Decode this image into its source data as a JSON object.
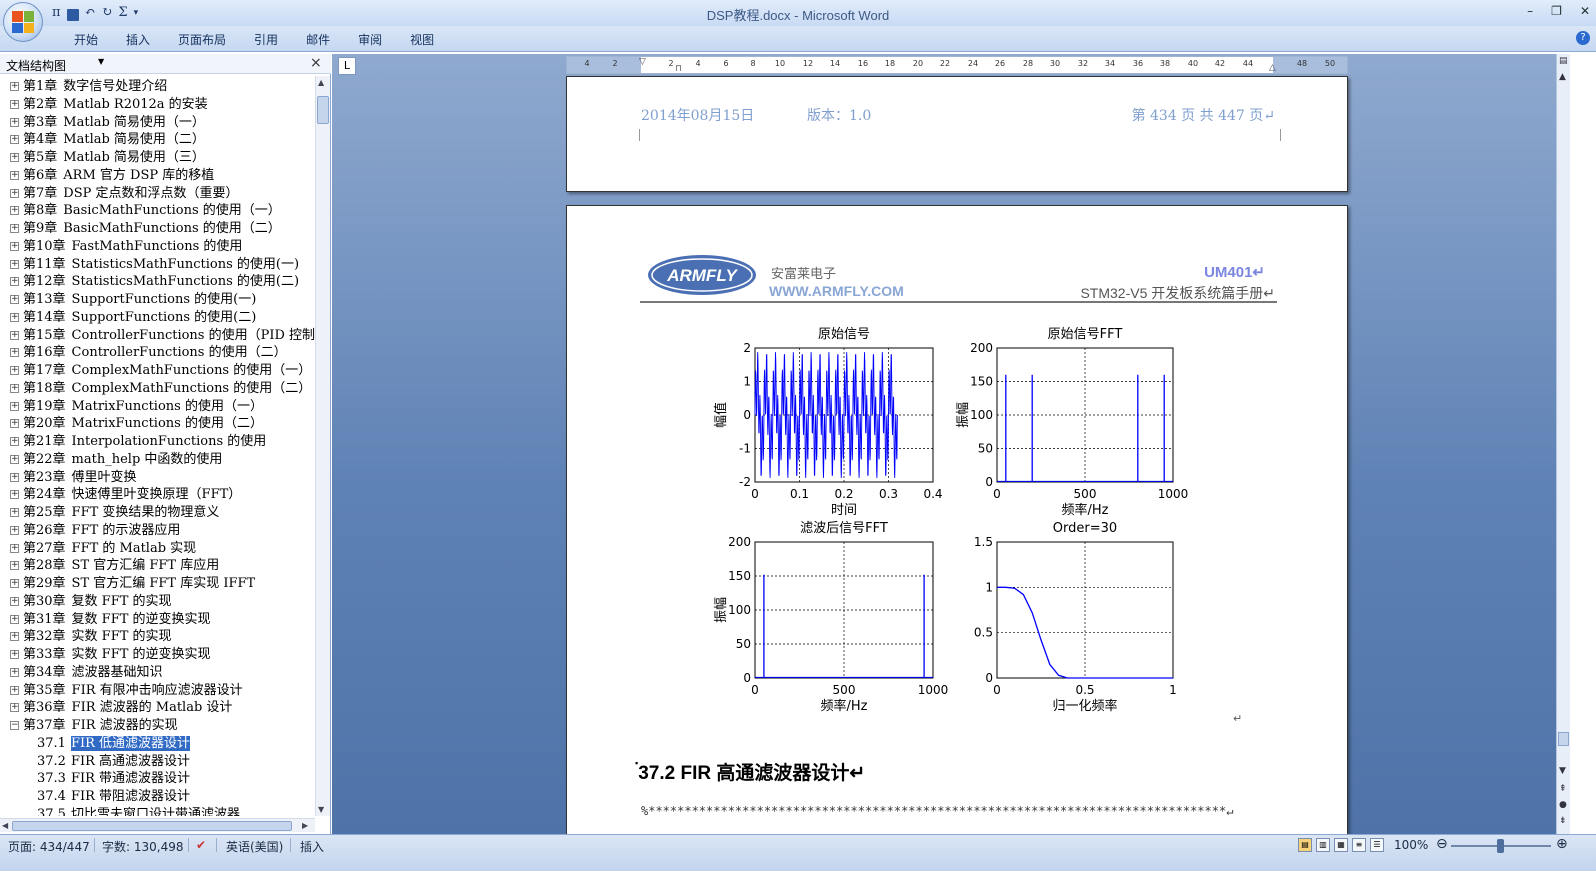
{
  "window": {
    "title": "DSP教程.docx - Microsoft Word",
    "qat": [
      "π",
      "💾",
      "↶",
      "↻",
      "Σ",
      "▾"
    ],
    "controls": [
      "–",
      "❐",
      "✕"
    ]
  },
  "ribbon": {
    "tabs": [
      "开始",
      "插入",
      "页面布局",
      "引用",
      "邮件",
      "审阅",
      "视图"
    ]
  },
  "nav": {
    "title": "文档结构图",
    "items": [
      {
        "prefix": "第1章",
        "text": "数字信号处理介绍",
        "exp": "⊞"
      },
      {
        "prefix": "第2章",
        "text": "Matlab R2012a 的安装",
        "exp": "⊞"
      },
      {
        "prefix": "第3章",
        "text": "Matlab  简易使用（一）",
        "exp": "⊞"
      },
      {
        "prefix": "第4章",
        "text": "Matlab  简易使用（二）",
        "exp": "⊞"
      },
      {
        "prefix": "第5章",
        "text": "Matlab  简易使用（三）",
        "exp": "⊞"
      },
      {
        "prefix": "第6章",
        "text": "ARM 官方 DSP 库的移植",
        "exp": "⊞"
      },
      {
        "prefix": "第7章",
        "text": "DSP 定点数和浮点数（重要）",
        "exp": "⊞"
      },
      {
        "prefix": "第8章",
        "text": "BasicMathFunctions 的使用（一）",
        "exp": "⊞"
      },
      {
        "prefix": "第9章",
        "text": "BasicMathFunctions 的使用（二）",
        "exp": "⊞"
      },
      {
        "prefix": "第10章",
        "text": "FastMathFunctions 的使用",
        "exp": "⊞"
      },
      {
        "prefix": "第11章",
        "text": "StatisticsMathFunctions 的使用(一)",
        "exp": "⊞"
      },
      {
        "prefix": "第12章",
        "text": "StatisticsMathFunctions 的使用(二)",
        "exp": "⊞"
      },
      {
        "prefix": "第13章",
        "text": "SupportFunctions 的使用(一)",
        "exp": "⊞"
      },
      {
        "prefix": "第14章",
        "text": "SupportFunctions 的使用(二)",
        "exp": "⊞"
      },
      {
        "prefix": "第15章",
        "text": "ControllerFunctions 的使用（PID 控制）",
        "exp": "⊞"
      },
      {
        "prefix": "第16章",
        "text": "ControllerFunctions 的使用（二）",
        "exp": "⊞"
      },
      {
        "prefix": "第17章",
        "text": "ComplexMathFunctions 的使用（一）",
        "exp": "⊞"
      },
      {
        "prefix": "第18章",
        "text": "ComplexMathFunctions 的使用（二）",
        "exp": "⊞"
      },
      {
        "prefix": "第19章",
        "text": "MatrixFunctions 的使用（一）",
        "exp": "⊞"
      },
      {
        "prefix": "第20章",
        "text": "MatrixFunctions 的使用（二）",
        "exp": "⊞"
      },
      {
        "prefix": "第21章",
        "text": "InterpolationFunctions 的使用",
        "exp": "⊞"
      },
      {
        "prefix": "第22章",
        "text": "math_help 中函数的使用",
        "exp": "⊞"
      },
      {
        "prefix": "第23章",
        "text": "傅里叶变换",
        "exp": "⊞"
      },
      {
        "prefix": "第24章",
        "text": "快速傅里叶变换原理（FFT）",
        "exp": "⊞"
      },
      {
        "prefix": "第25章",
        "text": "FFT 变换结果的物理意义",
        "exp": "⊞"
      },
      {
        "prefix": "第26章",
        "text": "FFT 的示波器应用",
        "exp": "⊞"
      },
      {
        "prefix": "第27章",
        "text": "FFT 的 Matlab 实现",
        "exp": "⊞"
      },
      {
        "prefix": "第28章",
        "text": "ST 官方汇编 FFT 库应用",
        "exp": "⊞"
      },
      {
        "prefix": "第29章",
        "text": "ST 官方汇编 FFT 库实现 IFFT",
        "exp": "⊞"
      },
      {
        "prefix": "第30章",
        "text": "复数 FFT 的实现",
        "exp": "⊞"
      },
      {
        "prefix": "第31章",
        "text": "复数 FFT 的逆变换实现",
        "exp": "⊞"
      },
      {
        "prefix": "第32章",
        "text": "实数 FFT 的实现",
        "exp": "⊞"
      },
      {
        "prefix": "第33章",
        "text": "实数 FFT 的逆变换实现",
        "exp": "⊞"
      },
      {
        "prefix": "第34章",
        "text": "滤波器基础知识",
        "exp": "⊞"
      },
      {
        "prefix": "第35章",
        "text": "FIR 有限冲击响应滤波器设计",
        "exp": "⊞"
      },
      {
        "prefix": "第36章",
        "text": "FIR 滤波器的 Matlab 设计",
        "exp": "⊞"
      },
      {
        "prefix": "第37章",
        "text": "FIR 滤波器的实现",
        "exp": "⊟"
      }
    ],
    "subitems": [
      {
        "prefix": "37.1",
        "text": "FIR 低通滤波器设计",
        "selected": true
      },
      {
        "prefix": "37.2",
        "text": "FIR 高通滤波器设计",
        "selected": false
      },
      {
        "prefix": "37.3",
        "text": "FIR 带通滤波器设计",
        "selected": false
      },
      {
        "prefix": "37.4",
        "text": "FIR 带阻滤波器设计",
        "selected": false
      },
      {
        "prefix": "37.5",
        "text": "切比雪夫窗口设计带通滤波器",
        "selected": false
      }
    ]
  },
  "ruler": {
    "corner": "L",
    "ticks": [
      "4",
      "2",
      "2",
      "4",
      "6",
      "8",
      "10",
      "12",
      "14",
      "16",
      "18",
      "20",
      "22",
      "24",
      "26",
      "28",
      "30",
      "32",
      "34",
      "36",
      "38",
      "40",
      "42",
      "44",
      "48",
      "50"
    ]
  },
  "page1": {
    "date": "2014年08月15日",
    "version": "版本：1.0",
    "pageinfo": "第  434  页    共  447  页↵"
  },
  "page2": {
    "logo_text": "ARMFLY",
    "company_cn": "安富莱电子",
    "url": "WWW.ARMFLY.COM",
    "um": "UM401↵",
    "manual": "STM32-V5 开发板系统篇手册↵",
    "section_title": "37.2 FIR 高通滤波器设计↵",
    "code_line": "%********************************************************************************↵",
    "para_mark": "↵"
  },
  "chart_data": [
    {
      "type": "line",
      "title": "原始信号",
      "xlabel": "时间",
      "ylabel": "幅值",
      "xlim": [
        0,
        0.4
      ],
      "ylim": [
        -2,
        2
      ],
      "xticks": [
        "0",
        "0.1",
        "0.2",
        "0.3",
        "0.4"
      ],
      "yticks": [
        "2",
        "1",
        "0",
        "-1",
        "-2"
      ],
      "grid": true,
      "series": [
        {
          "description": "sum of sinusoids, dense oscillation",
          "x_end": 0.32,
          "amplitude": 2
        }
      ]
    },
    {
      "type": "line",
      "title": "原始信号FFT",
      "xlabel": "频率/Hz",
      "ylabel": "振幅",
      "xlim": [
        0,
        1000
      ],
      "ylim": [
        0,
        200
      ],
      "xticks": [
        "0",
        "500",
        "1000"
      ],
      "yticks": [
        "200",
        "150",
        "100",
        "50",
        "0"
      ],
      "grid": true,
      "peaks": [
        {
          "x": 50,
          "y": 160
        },
        {
          "x": 200,
          "y": 160
        },
        {
          "x": 800,
          "y": 160
        },
        {
          "x": 950,
          "y": 160
        }
      ]
    },
    {
      "type": "line",
      "title": "滤波后信号FFT",
      "xlabel": "频率/Hz",
      "ylabel": "振幅",
      "xlim": [
        0,
        1000
      ],
      "ylim": [
        0,
        200
      ],
      "xticks": [
        "0",
        "500",
        "1000"
      ],
      "yticks": [
        "200",
        "150",
        "100",
        "50",
        "0"
      ],
      "grid": true,
      "peaks": [
        {
          "x": 50,
          "y": 152
        },
        {
          "x": 950,
          "y": 152
        }
      ]
    },
    {
      "type": "line",
      "title": "Order=30",
      "xlabel": "归一化频率",
      "ylabel": "",
      "xlim": [
        0,
        1
      ],
      "ylim": [
        0,
        1.5
      ],
      "xticks": [
        "0",
        "0.5",
        "1"
      ],
      "yticks": [
        "1.5",
        "1",
        "0.5",
        "0"
      ],
      "grid": true,
      "x": [
        0,
        0.05,
        0.1,
        0.15,
        0.2,
        0.25,
        0.3,
        0.35,
        0.4,
        0.5,
        0.6,
        0.8,
        1.0
      ],
      "y": [
        1.0,
        1.0,
        0.99,
        0.92,
        0.72,
        0.42,
        0.15,
        0.03,
        0.0,
        0.0,
        0.0,
        0.0,
        0.0
      ]
    }
  ],
  "status": {
    "page": "页面: 434/447",
    "words": "字数: 130,498",
    "lang": "英语(美国)",
    "mode": "插入",
    "zoom": "100%",
    "zoom_minus": "⊖",
    "zoom_plus": "⊕"
  },
  "colors": {
    "accent": "#316ac5",
    "plot_line": "#0000ff"
  }
}
